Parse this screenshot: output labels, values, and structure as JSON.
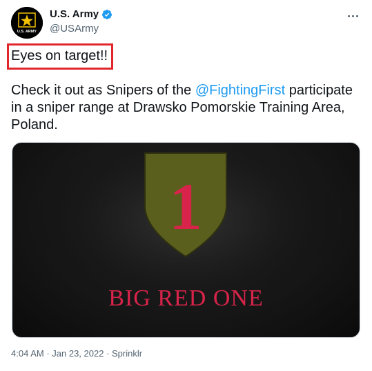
{
  "author": {
    "display_name": "U.S. Army",
    "handle": "@USArmy",
    "avatar_text": "U.S. ARMY",
    "verified_icon": "verified-badge-icon",
    "more_icon": "more-options-icon"
  },
  "tweet": {
    "headline": "Eyes on target!!",
    "body_prefix": "Check it out as Snipers of the ",
    "mention": "@FightingFirst",
    "body_suffix": " participate in a sniper range at Drawsko Pomorskie Training Area, Poland."
  },
  "media": {
    "caption": "BIG RED ONE",
    "numeral": "1"
  },
  "meta": {
    "time": "4:04 AM",
    "sep1": " · ",
    "date": "Jan 23, 2022",
    "sep2": " · ",
    "source": "Sprinklr"
  },
  "colors": {
    "accent": "#1d9bf0",
    "highlight_border": "#e0262b",
    "patch_fill": "#5b5f1d",
    "numeral": "#d8244a"
  }
}
